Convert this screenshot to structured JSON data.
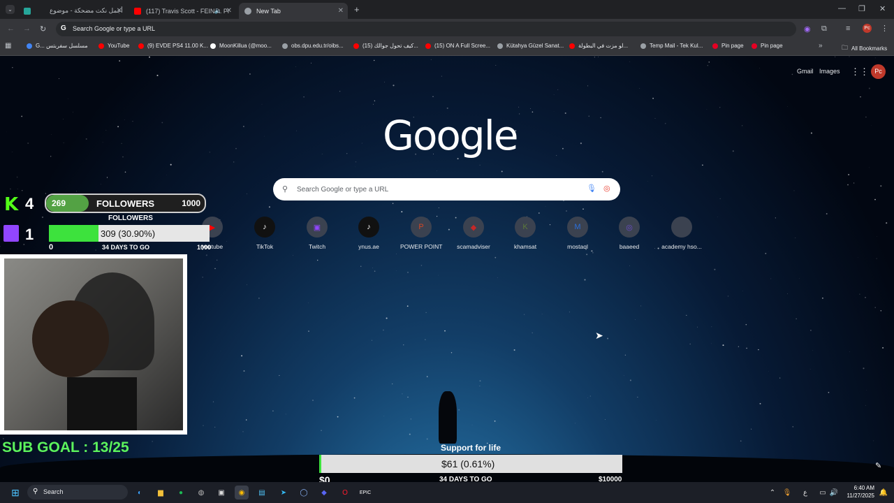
{
  "tabs": [
    {
      "title": "أجمل نكت مضحكة - موضوع",
      "color": "#26a69a"
    },
    {
      "title": "(117) Travis Scott - FEIN ft. Pl",
      "color": "#ff0000"
    },
    {
      "title": "New Tab",
      "color": "#9aa0a6"
    }
  ],
  "omnibox": {
    "placeholder": "Search Google or type a URL"
  },
  "bookmarks": [
    {
      "label": "G... مسلسل سفربتس",
      "color": "#4285f4"
    },
    {
      "label": "YouTube",
      "color": "#ff0000"
    },
    {
      "label": "(9) EVDE PS4 11.00 K...",
      "color": "#ff0000"
    },
    {
      "label": "MoonKillua (@moo...",
      "color": "#ffffff"
    },
    {
      "label": "obs.dpu.edu.tr/oibs...",
      "color": "#9aa0a6"
    },
    {
      "label": "(15) كيف تحول جوالك...",
      "color": "#ff0000"
    },
    {
      "label": "(15) ON A Full Scree...",
      "color": "#ff0000"
    },
    {
      "label": "Kütahya Güzel Sanat...",
      "color": "#9aa0a6"
    },
    {
      "label": "لو مزت في البطولة...",
      "color": "#ff0000"
    },
    {
      "label": "Temp Mail - Tek Kul...",
      "color": "#9aa0a6"
    },
    {
      "label": "Pin page",
      "color": "#e60023"
    },
    {
      "label": "Pin page",
      "color": "#e60023"
    }
  ],
  "all_bookmarks": "All Bookmarks",
  "header_links": {
    "gmail": "Gmail",
    "images": "Images",
    "avatar": "Pc"
  },
  "google_logo": "Google",
  "search": {
    "placeholder": "Search Google or type a URL"
  },
  "shortcuts": [
    {
      "label": "youtube",
      "glyph": "▶",
      "color": "#ff0000"
    },
    {
      "label": "TikTok",
      "glyph": "♪",
      "color": "#000000"
    },
    {
      "label": "Twitch",
      "glyph": "▣",
      "color": "#9146ff"
    },
    {
      "label": "ynus.ae",
      "glyph": "♪",
      "color": "#000000"
    },
    {
      "label": "POWER POINT",
      "glyph": "P",
      "color": "#d24726"
    },
    {
      "label": "scamadviser",
      "glyph": "◆",
      "color": "#c62828"
    },
    {
      "label": "khamsat",
      "glyph": "K",
      "color": "#5c7a3a"
    },
    {
      "label": "mostaql",
      "glyph": "M",
      "color": "#2a6fdb"
    },
    {
      "label": "baaeed",
      "glyph": "◎",
      "color": "#6a4cc9"
    },
    {
      "label": "academy hso...",
      "glyph": "",
      "color": "#555555"
    }
  ],
  "kick": {
    "logo": "K",
    "count": "4",
    "current": "269",
    "label": "FOLLOWERS",
    "goal": "1000"
  },
  "twitch": {
    "count": "1",
    "title": "FOLLOWERS",
    "progress_text": "309 (30.90%)",
    "progress": 0.309,
    "min": "0",
    "days": "34 DAYS TO GO",
    "max": "1000"
  },
  "sub_goal": "SUB GOAL : 13/25",
  "support": {
    "title": "Support for life",
    "progress_text": "$61 (0.61%)",
    "progress": 0.0061,
    "min": "$0",
    "days": "34 DAYS TO GO",
    "max": "$10000"
  },
  "taskbar": {
    "search": "Search",
    "time": "6:40 AM",
    "date": "11/27/2025",
    "lang": "ع"
  }
}
